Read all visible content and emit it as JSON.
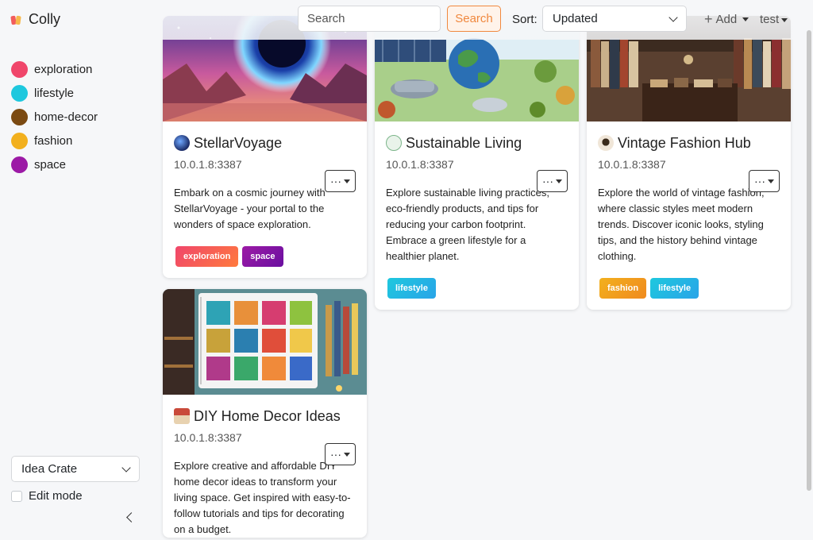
{
  "app": {
    "name": "Colly"
  },
  "sidebar": {
    "categories": [
      {
        "label": "exploration",
        "color": "#f0466b"
      },
      {
        "label": "lifestyle",
        "color": "#1ec8de"
      },
      {
        "label": "home-decor",
        "color": "#7b4a12"
      },
      {
        "label": "fashion",
        "color": "#f2b01e"
      },
      {
        "label": "space",
        "color": "#9c1aa6"
      }
    ],
    "crate_select": {
      "value": "Idea Crate"
    },
    "edit_mode_label": "Edit mode"
  },
  "toolbar": {
    "search_placeholder": "Search",
    "search_button": "Search",
    "sort_label": "Sort:",
    "sort_value": "Updated",
    "add_label": "Add",
    "user_label": "test"
  },
  "cards": [
    {
      "title": "StellarVoyage",
      "host": "10.0.1.8:3387",
      "description": "Embark on a cosmic journey with StellarVoyage - your portal to the wonders of space exploration.",
      "more": "···",
      "tags": [
        {
          "label": "exploration",
          "color": "#f0466b"
        },
        {
          "label": "space",
          "color": "#9c1aa6"
        }
      ]
    },
    {
      "title": "Sustainable Living",
      "host": "10.0.1.8:3387",
      "description": "Explore sustainable living practices, eco-friendly products, and tips for reducing your carbon footprint. Embrace a green lifestyle for a healthier planet.",
      "more": "···",
      "tags": [
        {
          "label": "lifestyle",
          "color": "#1ec8de"
        }
      ]
    },
    {
      "title": "Vintage Fashion Hub",
      "host": "10.0.1.8:3387",
      "description": "Explore the world of vintage fashion, where classic styles meet modern trends. Discover iconic looks, styling tips, and the history behind vintage clothing.",
      "more": "···",
      "tags": [
        {
          "label": "fashion",
          "color": "#f2b01e"
        },
        {
          "label": "lifestyle",
          "color": "#1ec8de"
        }
      ]
    },
    {
      "title": "DIY Home Decor Ideas",
      "host": "10.0.1.8:3387",
      "description": "Explore creative and affordable DIY home decor ideas to transform your living space. Get inspired with easy-to-follow tutorials and tips for decorating on a budget.",
      "more": "···",
      "tags": []
    }
  ]
}
